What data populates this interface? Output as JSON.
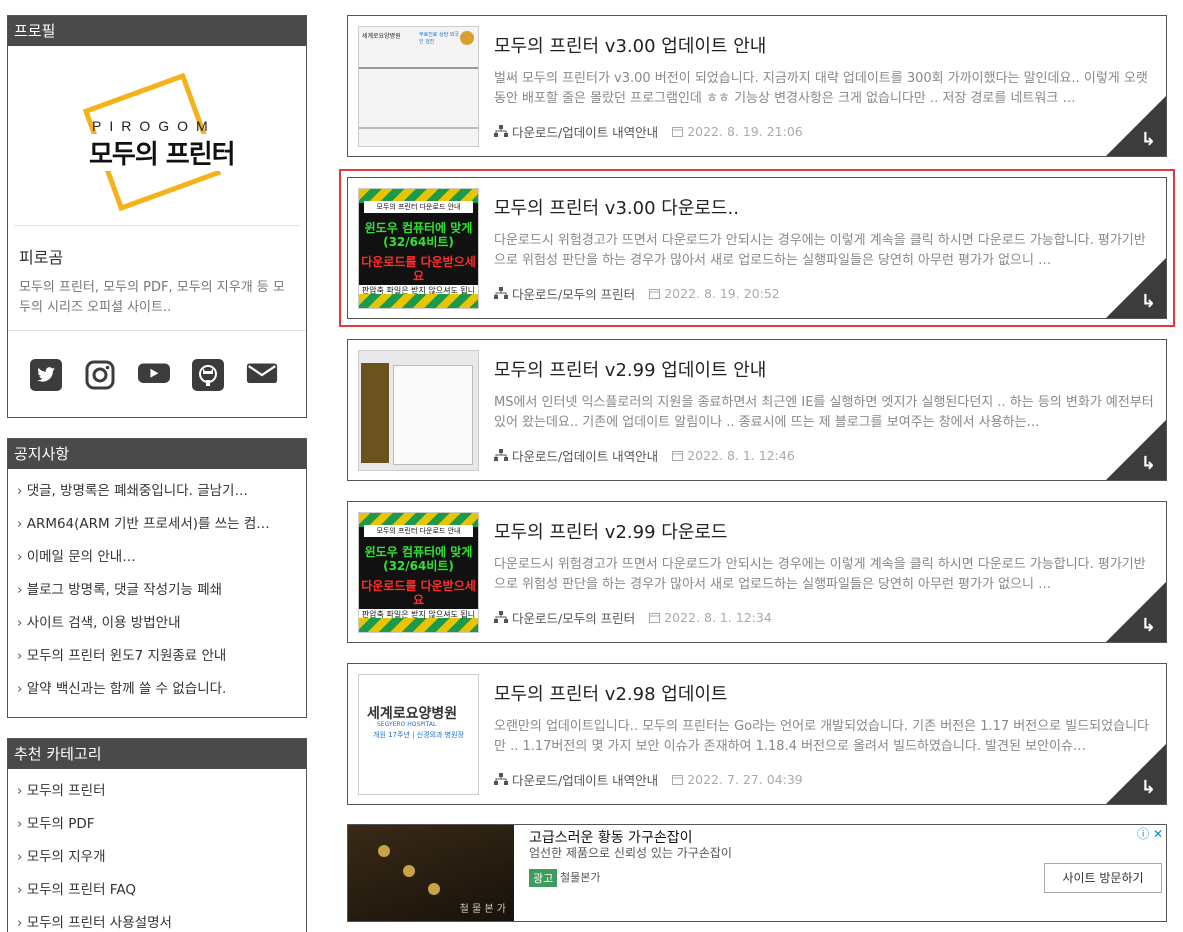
{
  "profile": {
    "title": "프로필",
    "logo_top": "PIROGOM",
    "logo_main": "모두의 프린터",
    "name": "피로곰",
    "desc": "모두의 프린터, 모두의 PDF, 모두의 지우개 등 모두의 시리즈 오피셜 사이트..",
    "socials": [
      "twitter-icon",
      "instagram-icon",
      "youtube-icon",
      "github-icon",
      "mail-icon"
    ]
  },
  "notice": {
    "title": "공지사항",
    "items": [
      "댓글, 방명록은 폐쇄중입니다. 글남기…",
      "ARM64(ARM 기반 프로세서)를 쓰는 컴…",
      "이메일 문의 안내…",
      "블로그 방명록, 댓글 작성기능 폐쇄",
      "사이트 검색, 이용 방법안내",
      "모두의 프린터 윈도7 지원종료 안내",
      "알약 백신과는 함께 쓸 수 없습니다."
    ]
  },
  "category": {
    "title": "추천 카테고리",
    "items": [
      "모두의 프린터",
      "모두의 PDF",
      "모두의 지우개",
      "모두의 프린터 FAQ",
      "모두의 프린터 사용설명서"
    ]
  },
  "posts": [
    {
      "title": "모두의 프린터 v3.00 업데이트 안내",
      "excerpt": "벌써 모두의 프린터가 v3.00 버전이 되었습니다. 지금까지 대략 업데이트를 300회 가까이했다는 말인데요.. 이렇게 오랫동안 배포할 줄은 몰랐던 프로그램인데 ㅎㅎ 기능상 변경사항은 크게 없습니다만 .. 저장 경로를 네트워크 …",
      "category": "다운로드/업데이트 내역안내",
      "date": "2022. 8. 19. 21:06",
      "thumb": {
        "hdr": "세계로요양병원",
        "blue": "무료진료 상담 외국인 검진"
      }
    },
    {
      "title": "모두의 프린터 v3.00 다운로드..",
      "excerpt": "다운로드시 위험경고가 뜨면서 다운로드가 안되시는 경우에는 이렇게 계속을 클릭 하시면 다운로드 가능합니다. 평가기반으로 위험성 판단을 하는 경우가 많아서 새로 업로드하는 실행파일들은 당연히 아무런 평가가 없으니 …",
      "category": "다운로드/모두의 프린터",
      "date": "2022. 8. 19. 20:52",
      "thumb": {
        "lbl": "모두의 프린터 다운로드 안내",
        "g1": "윈도우 컴퓨터에 맞게 (32/64비트)",
        "g2": "다운로드를 다운받으세요",
        "g3": "판압축 파일은 받지 않으셔도 됩니다"
      }
    },
    {
      "title": "모두의 프린터 v2.99 업데이트 안내",
      "excerpt": "MS에서 인터넷 익스플로러의 지원을 종료하면서 최근엔 IE를 실행하면 엣지가 실행된다던지 .. 하는 등의 변화가 예전부터 있어 왔는데요.. 기존에 업데이트 알림이나 .. 종료시에 뜨는 제 블로그를 보여주는 창에서 사용하는…",
      "category": "다운로드/업데이트 내역안내",
      "date": "2022. 8. 1. 12:46"
    },
    {
      "title": "모두의 프린터 v2.99 다운로드",
      "excerpt": "다운로드시 위험경고가 뜨면서 다운로드가 안되시는 경우에는 이렇게 계속을 클릭 하시면 다운로드 가능합니다. 평가기반으로 위험성 판단을 하는 경우가 많아서 새로 업로드하는 실행파일들은 당연히 아무런 평가가 없으니 …",
      "category": "다운로드/모두의 프린터",
      "date": "2022. 8. 1. 12:34",
      "thumb": {
        "lbl": "모두의 프린터 다운로드 안내",
        "g1": "윈도우 컴퓨터에 맞게 (32/64비트)",
        "g2": "다운로드를 다운받으세요",
        "g3": "판압축 파일은 받지 않으셔도 됩니다"
      }
    },
    {
      "title": "모두의 프린터 v2.98 업데이트",
      "excerpt": "오랜만의 업데이트입니다.. 모두의 프린터는 Go라는 언어로 개발되었습니다. 기존 버전은 1.17 버전으로 빌드되었습니다만 .. 1.17버전의 몇 가지 보안 이슈가 존재하여 1.18.4 버전으로 올려서 빌드하였습니다. 발견된 보안이슈…",
      "category": "다운로드/업데이트 내역안내",
      "date": "2022. 7. 27. 04:39",
      "thumb": {
        "t1": "세계로요양병원",
        "t2": "SEGYERO HOSPITAL",
        "t3": "개원 17주년 | 신경외과 병원장"
      }
    }
  ],
  "ad": {
    "title": "고급스러운 황동 가구손잡이",
    "desc": "엄선한 제품으로 신뢰성 있는 가구손잡이",
    "badge": "광고",
    "source": "철물본가",
    "button": "사이트 방문하기",
    "info": "ⓘ ✕",
    "brand": "철 물 본 가"
  },
  "colors": {
    "accent": "#f5b21b",
    "dark": "#4a4a4a",
    "highlight": "#e0393b"
  }
}
